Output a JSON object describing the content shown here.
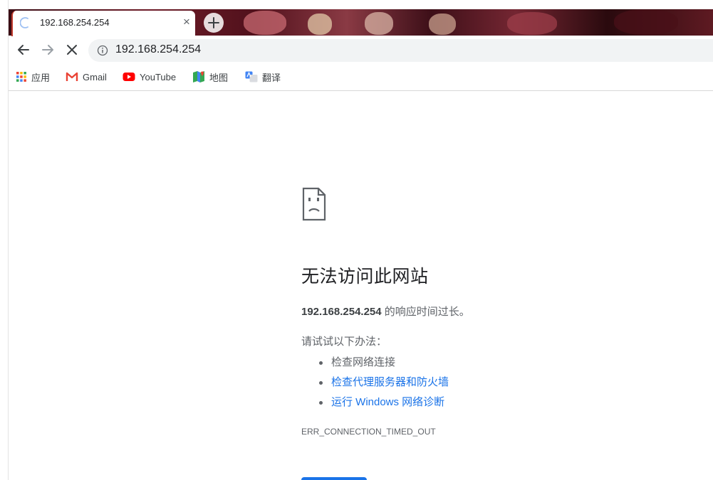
{
  "tab": {
    "title": "192.168.254.254",
    "close_glyph": "×",
    "new_tab_glyph": "+"
  },
  "toolbar": {
    "back_icon": "back-arrow-icon",
    "forward_icon": "forward-arrow-icon",
    "stop_icon": "stop-icon",
    "url": "192.168.254.254"
  },
  "bookmarks": [
    {
      "icon": "apps-grid-icon",
      "label": "应用"
    },
    {
      "icon": "gmail-icon",
      "label": "Gmail"
    },
    {
      "icon": "youtube-icon",
      "label": "YouTube"
    },
    {
      "icon": "maps-icon",
      "label": "地图"
    },
    {
      "icon": "translate-icon",
      "label": "翻译"
    }
  ],
  "error": {
    "title": "无法访问此网站",
    "host": "192.168.254.254",
    "description_suffix": " 的响应时间过长。",
    "try_label": "请试试以下办法：",
    "suggestions": [
      {
        "text": "检查网络连接",
        "link": false
      },
      {
        "text": "检查代理服务器和防火墙",
        "link": true
      },
      {
        "text": "运行 Windows 网络诊断",
        "link": true
      }
    ],
    "code": "ERR_CONNECTION_TIMED_OUT"
  },
  "colors": {
    "accent": "#1a73e8",
    "text_primary": "#202124",
    "text_secondary": "#5f6368",
    "omnibox_bg": "#f1f3f4"
  }
}
